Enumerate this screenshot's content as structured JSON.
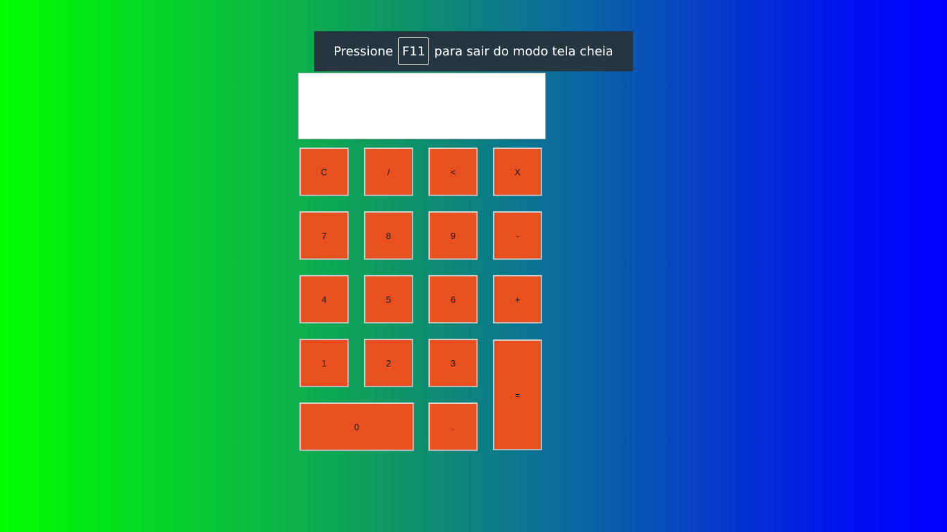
{
  "fullscreen_notice": {
    "prefix": "Pressione",
    "key": "F11",
    "suffix": "para sair do modo tela cheia"
  },
  "display": {
    "value": ""
  },
  "keys": {
    "clear": "C",
    "divide": "/",
    "backspace": "<",
    "multiply": "X",
    "seven": "7",
    "eight": "8",
    "nine": "9",
    "minus": "-",
    "four": "4",
    "five": "5",
    "six": "6",
    "plus": "+",
    "one": "1",
    "two": "2",
    "three": "3",
    "equals": "=",
    "zero": "0",
    "decimal": "."
  },
  "colors": {
    "button": "#e8501f",
    "notice_bg": "#263640",
    "gradient_start": "#00ff00",
    "gradient_end": "#0000ff"
  }
}
